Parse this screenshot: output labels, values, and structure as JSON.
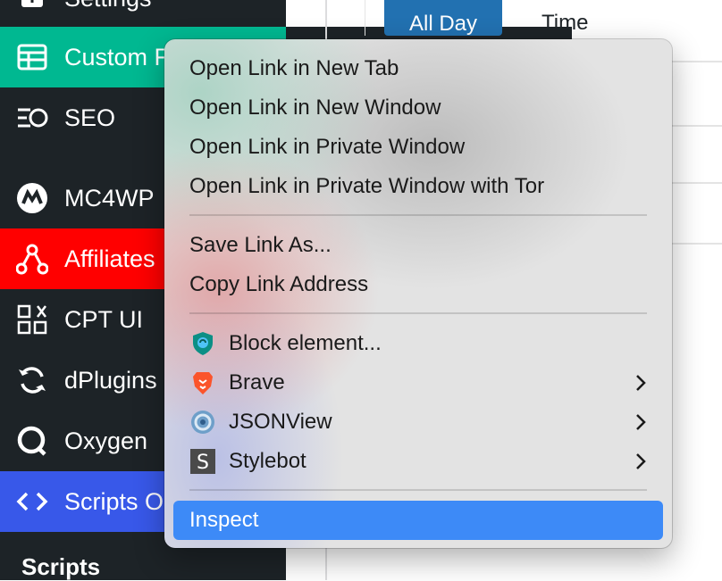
{
  "colors": {
    "sidebar_bg": "#1d2327",
    "custom_active": "#00b891",
    "affiliates_active": "#ff0000",
    "scripts_active": "#3858e9",
    "menu_highlight": "#3d8af7",
    "primary_button": "#2271b1"
  },
  "sidebar": {
    "items": [
      {
        "label": "Settings",
        "icon": "plus-square-icon"
      },
      {
        "label": "Custom F",
        "icon": "table-icon"
      },
      {
        "label": "SEO",
        "icon": "seo-bars-icon"
      },
      {
        "label": "MC4WP",
        "icon": "mc4wp-icon"
      },
      {
        "label": "Affiliates",
        "icon": "affiliates-nodes-icon"
      },
      {
        "label": "CPT UI",
        "icon": "grid-squares-icon"
      },
      {
        "label": "dPlugins",
        "icon": "refresh-arrows-icon"
      },
      {
        "label": "Oxygen",
        "icon": "oxygen-icon"
      },
      {
        "label": "Scripts O",
        "icon": "code-brackets-icon"
      }
    ],
    "submenu_heading": "Scripts"
  },
  "page": {
    "allday_button": "All Day",
    "time_label": "Time"
  },
  "context_menu": {
    "group1": [
      "Open Link in New Tab",
      "Open Link in New Window",
      "Open Link in Private Window",
      "Open Link in Private Window with Tor"
    ],
    "group2": [
      "Save Link As...",
      "Copy Link Address"
    ],
    "extensions": [
      {
        "label": "Block element...",
        "icon": "adblock-shield-icon",
        "submenu": false
      },
      {
        "label": "Brave",
        "icon": "brave-lion-icon",
        "submenu": true
      },
      {
        "label": "JSONView",
        "icon": "jsonview-icon",
        "submenu": true
      },
      {
        "label": "Stylebot",
        "icon": "stylebot-s-icon",
        "submenu": true
      }
    ],
    "inspect": "Inspect"
  }
}
